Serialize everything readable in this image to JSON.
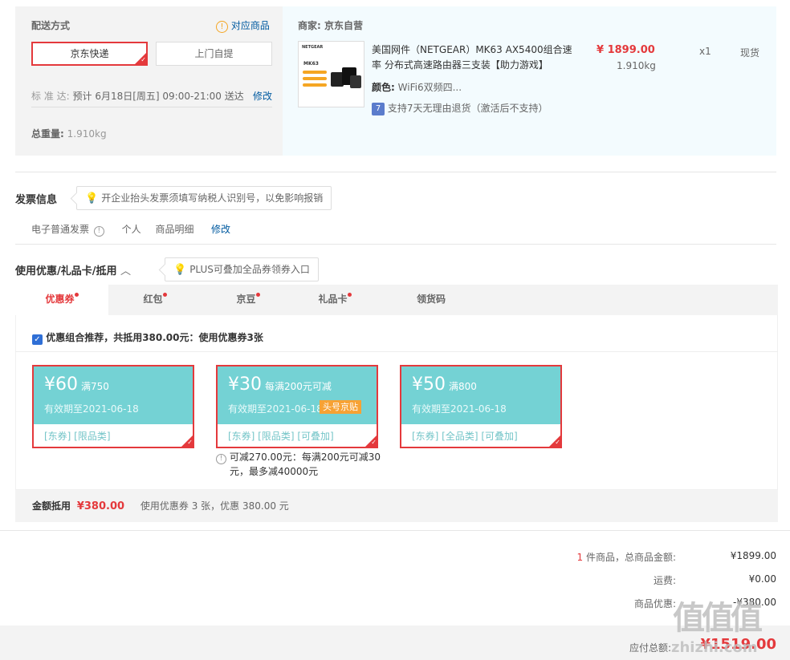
{
  "delivery": {
    "title": "配送方式",
    "match_link": "对应商品",
    "options": [
      "京东快递",
      "上门自提"
    ],
    "standard_label": "标 准 达:",
    "standard_value": "预计 6月18日[周五] 09:00-21:00 送达",
    "modify": "修改",
    "weight_label": "总重量:",
    "weight_value": "1.910kg"
  },
  "shop": {
    "merchant_label": "商家:",
    "merchant_name": "京东自营",
    "product_title_line1": "美国网件（NETGEAR）MK63 AX5400组合速",
    "product_title_line2": "率 分布式高速路由器三支装【助力游戏】",
    "price": "¥ 1899.00",
    "weight": "1.910kg",
    "qty": "x1",
    "stock": "现货",
    "color_label": "颜色:",
    "color_value": "WiFi6双频四...",
    "return_icon": "7",
    "return_text": "支持7天无理由退货（激活后不支持）",
    "img_brand": "NETGEAR",
    "img_model": "MK63"
  },
  "invoice": {
    "title": "发票信息",
    "tip": "开企业抬头发票须填写纳税人识别号，以免影响报销",
    "type": "电子普通发票",
    "who": "个人",
    "content": "商品明细",
    "modify": "修改"
  },
  "discount": {
    "title": "使用优惠/礼品卡/抵用",
    "tip": "PLUS可叠加全品券领券入口",
    "tabs": [
      "优惠券",
      "红包",
      "京豆",
      "礼品卡",
      "领货码"
    ],
    "combo_text": "优惠组合推荐，共抵用380.00元：使用优惠券3张",
    "coupons": [
      {
        "amount": "¥60",
        "cond": "满750",
        "expire": "有效期至2021-06-18",
        "tags": "[东券]  [限品类]",
        "badge": ""
      },
      {
        "amount": "¥30",
        "cond": "每满200元可减",
        "expire": "有效期至2021-06-18",
        "tags": "[东券]  [限品类]  [可叠加]",
        "badge": "头号京贴"
      },
      {
        "amount": "¥50",
        "cond": "满800",
        "expire": "有效期至2021-06-18",
        "tags": "[东券]  [全品类]  [可叠加]",
        "badge": ""
      }
    ],
    "coupon2_note_line1": "可减270.00元：每满200元可减30",
    "coupon2_note_line2": "元，最多减40000元",
    "sum_label": "金额抵用",
    "sum_value": "¥380.00",
    "sum_desc": "使用优惠券 3 张，优惠 380.00 元"
  },
  "totals": {
    "count_num": "1",
    "count_text": "件商品，总商品金额:",
    "goods_total": "¥1899.00",
    "shipping_label": "运费:",
    "shipping_value": "¥0.00",
    "discount_label": "商品优惠:",
    "discount_value": "-¥380.00",
    "payable_label": "应付总额:",
    "payable_value": "¥1519.00"
  },
  "watermark": {
    "logo": "值值值",
    "site": "zhizhi.com"
  },
  "colors": {
    "accent": "#e4393c",
    "link": "#005aa0",
    "coupon": "#74d2d4",
    "badge": "#f7a234"
  }
}
